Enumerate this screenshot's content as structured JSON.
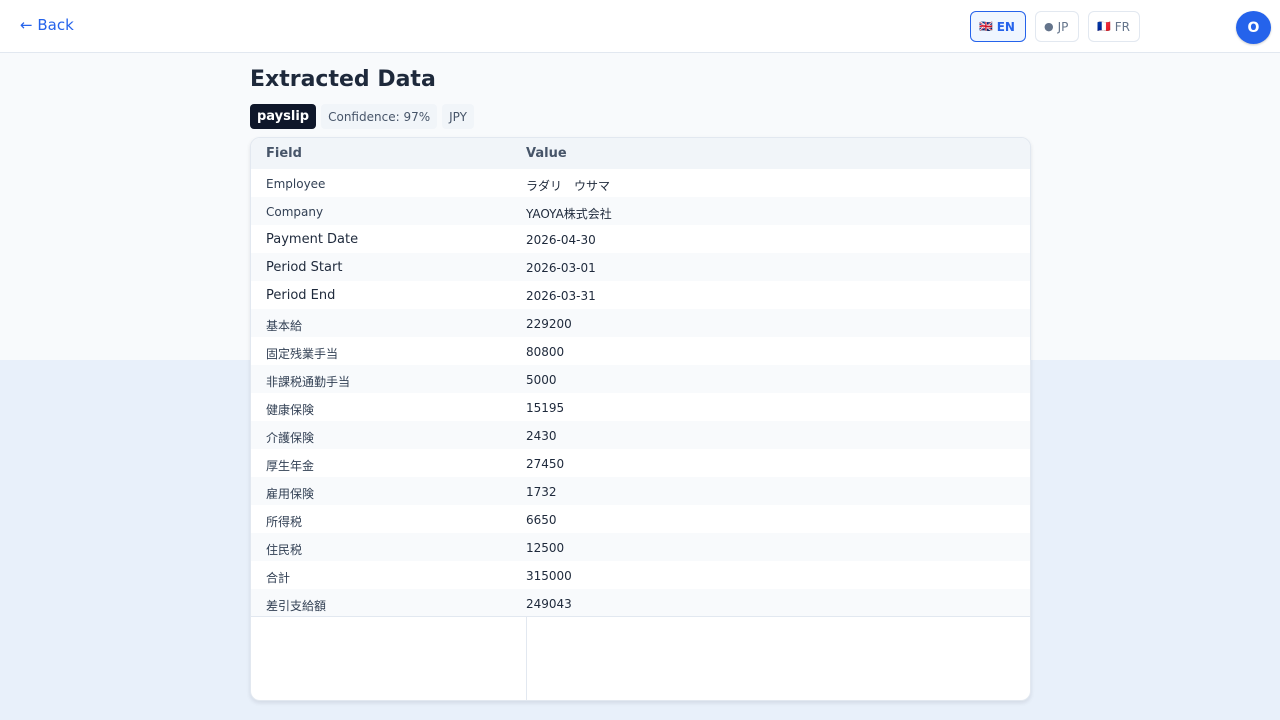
{
  "header": {
    "back_label": "← Back",
    "languages": [
      {
        "flag": "🇬🇧",
        "code": "EN",
        "active": true
      },
      {
        "flag": "●",
        "code": "JP",
        "active": false
      },
      {
        "flag": "🇫🇷",
        "code": "FR",
        "active": false
      }
    ],
    "avatar_initial": "O"
  },
  "main": {
    "title": "Extracted Data",
    "badges": {
      "doc_type": "payslip",
      "confidence": "Confidence: 97%",
      "currency": "JPY"
    },
    "table": {
      "headers": {
        "field": "Field",
        "value": "Value"
      },
      "rows": [
        {
          "field": "Employee",
          "value": "ラダリ　ウサマ"
        },
        {
          "field": "Company",
          "value": "YAOYA株式会社"
        },
        {
          "field": "Payment Date",
          "value": "2026-04-30"
        },
        {
          "field": "Period Start",
          "value": "2026-03-01"
        },
        {
          "field": "Period End",
          "value": "2026-03-31"
        },
        {
          "field": "基本給",
          "value": "229200"
        },
        {
          "field": "固定残業手当",
          "value": "80800"
        },
        {
          "field": "非課税通勤手当",
          "value": "5000"
        },
        {
          "field": "健康保険",
          "value": "15195"
        },
        {
          "field": "介護保険",
          "value": "2430"
        },
        {
          "field": "厚生年金",
          "value": "27450"
        },
        {
          "field": "雇用保険",
          "value": "1732"
        },
        {
          "field": "所得税",
          "value": "6650"
        },
        {
          "field": "住民税",
          "value": "12500"
        },
        {
          "field": "合計",
          "value": "315000"
        },
        {
          "field": "差引支給額",
          "value": "249043"
        }
      ]
    }
  },
  "colors": {
    "accent": "#2563eb",
    "type_badge_bg": "#0f172a"
  }
}
